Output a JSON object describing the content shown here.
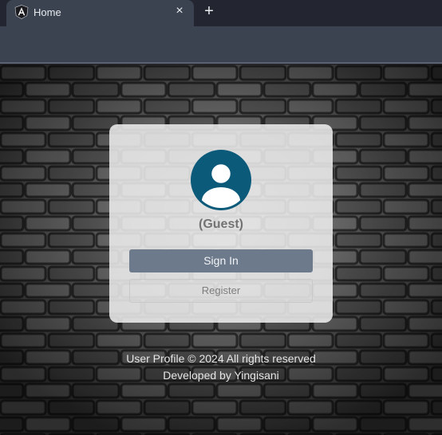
{
  "browser": {
    "tab": {
      "title": "Home",
      "close_glyph": "×",
      "logo_icon": "angular-logo-icon"
    },
    "new_tab_glyph": "+"
  },
  "profile_card": {
    "avatar_icon": "user-avatar-icon",
    "avatar_color": "#0b5a7a",
    "username": "(Guest)",
    "sign_in_label": "Sign In",
    "register_label": "Register"
  },
  "footer": {
    "line1": "User Profile © 2024 All rights reserved",
    "line2": "Developed by Yingisani"
  },
  "colors": {
    "sign_in_button": "#6c7a8c",
    "card_background": "#f0f0f0"
  }
}
